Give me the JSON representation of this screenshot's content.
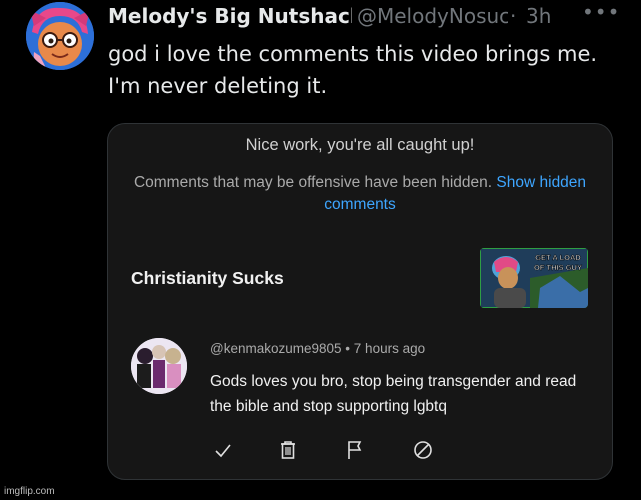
{
  "tweet": {
    "display_name": "Melody's Big Nutshack",
    "handle": "@MelodyNosuchthing",
    "separator": "·",
    "time": "3h",
    "more": "•••",
    "text": "god i love the comments this video brings me. I'm never deleting it."
  },
  "embed": {
    "caught_up": "Nice work, you're all caught up!",
    "hidden_notice": "Comments that may be offensive have been hidden.",
    "show_link": "Show hidden comments",
    "video_title": "Christianity Sucks",
    "thumbnail_text": "GET A LOAD OF THIS GUY",
    "comment": {
      "author": "@kenmakozume9805",
      "separator": "•",
      "time": "7 hours ago",
      "text": "Gods loves you bro, stop being transgender and read the bible and stop supporting lgbtq"
    },
    "actions": [
      {
        "icon": "checkmark-icon"
      },
      {
        "icon": "trash-icon"
      },
      {
        "icon": "flag-icon"
      },
      {
        "icon": "block-icon"
      }
    ]
  },
  "watermark": "imgflip.com",
  "colors": {
    "background": "#000000",
    "link_blue": "#3ea6ff",
    "muted": "#71767b"
  }
}
